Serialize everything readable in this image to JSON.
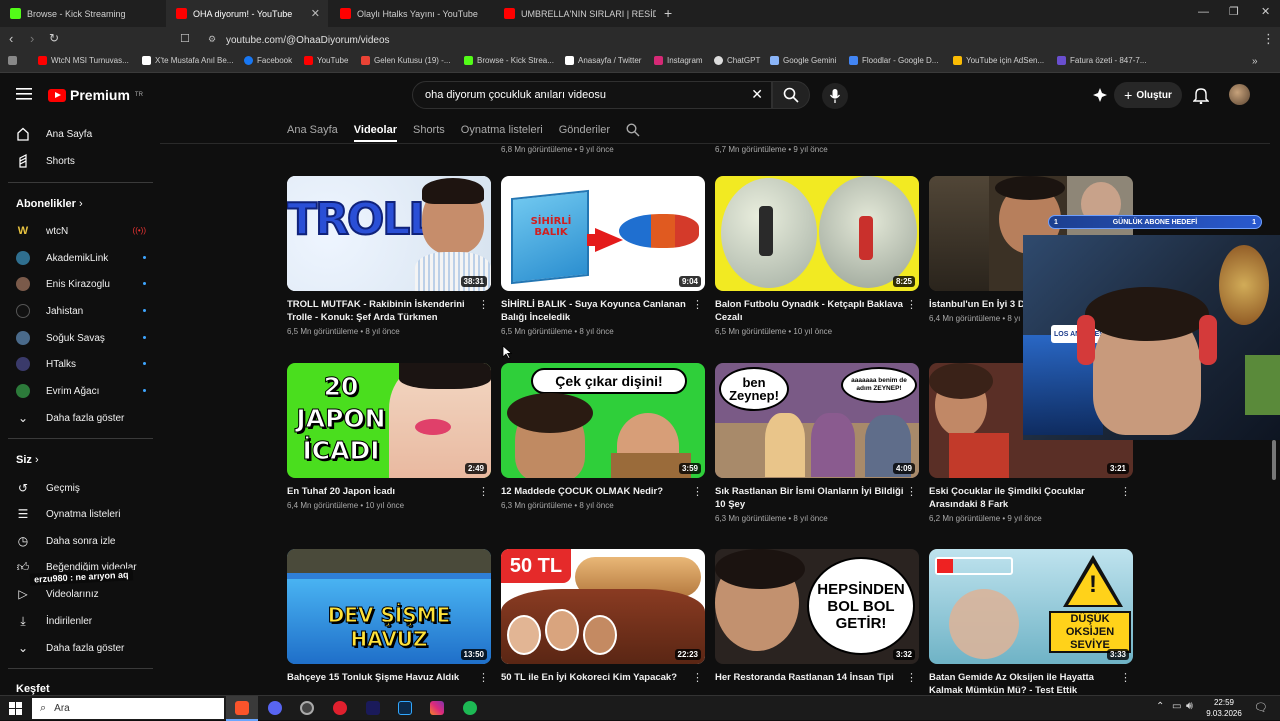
{
  "browser": {
    "tabs": [
      {
        "title": "Browse - Kick Streaming",
        "color": "#53fc18"
      },
      {
        "title": "OHA diyorum! - YouTube",
        "color": "#ff0000"
      },
      {
        "title": "Olaylı Htalks Yayını - YouTube",
        "color": "#ff0000"
      },
      {
        "title": "UMBRELLA'NIN SIRLARI | RESİDENT E",
        "color": "#ff0000"
      }
    ],
    "url": "youtube.com/@OhaaDiyorum/videos",
    "bookmarks": [
      "WtcN MSI Turnuvas...",
      "X'te Mustafa Anıl Be...",
      "Facebook",
      "YouTube",
      "Gelen Kutusu (19) -...",
      "Browse - Kick Strea...",
      "Anasayfa / Twitter",
      "Instagram",
      "ChatGPT",
      "Google Gemini",
      "Floodlar - Google D...",
      "YouTube için AdSen...",
      "Fatura özeti - 847-7..."
    ]
  },
  "header": {
    "logo": "Premium",
    "logo_region": "TR",
    "search_value": "oha diyorum çocukluk anıları videosu",
    "create_label": "Oluştur"
  },
  "sidebar": {
    "main": [
      "Ana Sayfa",
      "Shorts"
    ],
    "subs_title": "Abonelikler",
    "subs": [
      "wtcN",
      "AkademikLink",
      "Enis Kirazoglu",
      "Jahistan",
      "Soğuk Savaş",
      "HTalks",
      "Evrim Ağacı"
    ],
    "show_more": "Daha fazla göster",
    "you_title": "Siz",
    "you": [
      "Geçmiş",
      "Oynatma listeleri",
      "Daha sonra izle",
      "Beğendiğim videolar",
      "Videolarınız",
      "İndirilenler"
    ],
    "show_more2": "Daha fazla göster",
    "explore": "Keşfet"
  },
  "channel_tabs": [
    "Ana Sayfa",
    "Videolar",
    "Shorts",
    "Oynatma listeleri",
    "Gönderiler"
  ],
  "prev_meta": [
    "6,8 Mn görüntüleme • 9 yıl önce",
    "6,7 Mn görüntüleme • 9 yıl önce"
  ],
  "videos": [
    {
      "title": "TROLL MUTFAK - Rakibinin İskenderini Trolle - Konuk: Şef Arda Türkmen",
      "meta": "6,5 Mn görüntüleme • 8 yıl önce",
      "duration": "38:31",
      "thumb_text": "TROLL"
    },
    {
      "title": "SİHİRLİ BALIK - Suya Koyunca Canlanan Balığı İnceledik",
      "meta": "6,5 Mn görüntüleme • 8 yıl önce",
      "duration": "9:04",
      "thumb_text": "SİHİRLİ BALIK"
    },
    {
      "title": "Balon Futbolu Oynadık - Ketçaplı Baklava Cezalı",
      "meta": "6,5 Mn görüntüleme • 10 yıl önce",
      "duration": "8:25",
      "thumb_text": ""
    },
    {
      "title": "İstanbul'un En İyi 3 Dö",
      "meta": "6,4 Mn görüntüleme • 8 yı",
      "duration": "",
      "thumb_text": ""
    },
    {
      "title": "En Tuhaf 20 Japon İcadı",
      "meta": "6,4 Mn görüntüleme • 10 yıl önce",
      "duration": "2:49",
      "thumb_text": "20 JAPON İCADI"
    },
    {
      "title": "12 Maddede ÇOCUK OLMAK Nedir?",
      "meta": "6,3 Mn görüntüleme • 8 yıl önce",
      "duration": "3:59",
      "thumb_text": "Çek çıkar dişini!"
    },
    {
      "title": "Sık Rastlanan Bir İsmi Olanların İyi Bildiği 10 Şey",
      "meta": "6,3 Mn görüntüleme • 8 yıl önce",
      "duration": "4:09",
      "thumb_text": "ben Zeynep!"
    },
    {
      "title": "Eski Çocuklar ile Şimdiki Çocuklar Arasındaki 8 Fark",
      "meta": "6,2 Mn görüntüleme • 9 yıl önce",
      "duration": "3:21",
      "thumb_text": ""
    },
    {
      "title": "Bahçeye 15 Tonluk Şişme Havuz Aldık",
      "meta": "",
      "duration": "13:50",
      "thumb_text": "DEV ŞİŞME HAVUZ"
    },
    {
      "title": "50 TL ile En İyi Kokoreci Kim Yapacak?",
      "meta": "",
      "duration": "22:23",
      "thumb_text": "50 TL"
    },
    {
      "title": "Her Restoranda Rastlanan 14 İnsan Tipi",
      "meta": "",
      "duration": "3:32",
      "thumb_text": "HEPSİNDEN BOL BOL GETİR!"
    },
    {
      "title": "Batan Gemide Az Oksijen ile Hayatta Kalmak Mümkün Mü? - Test Ettik",
      "meta": "",
      "duration": "3:33",
      "thumb_text": "DÜŞÜK OKSİJEN SEVİYE"
    }
  ],
  "overlay": {
    "goal_label": "GÜNLÜK ABONE HEDEFİ",
    "goal_left": "1",
    "goal_right": "1",
    "chat": "erzu980 : ne arıyon aq",
    "bubble2": "aaaaaaa benim de adım ZEYNEP!"
  },
  "taskbar": {
    "search_placeholder": "Ara",
    "time": "22:59",
    "date": "9.03.2026"
  }
}
